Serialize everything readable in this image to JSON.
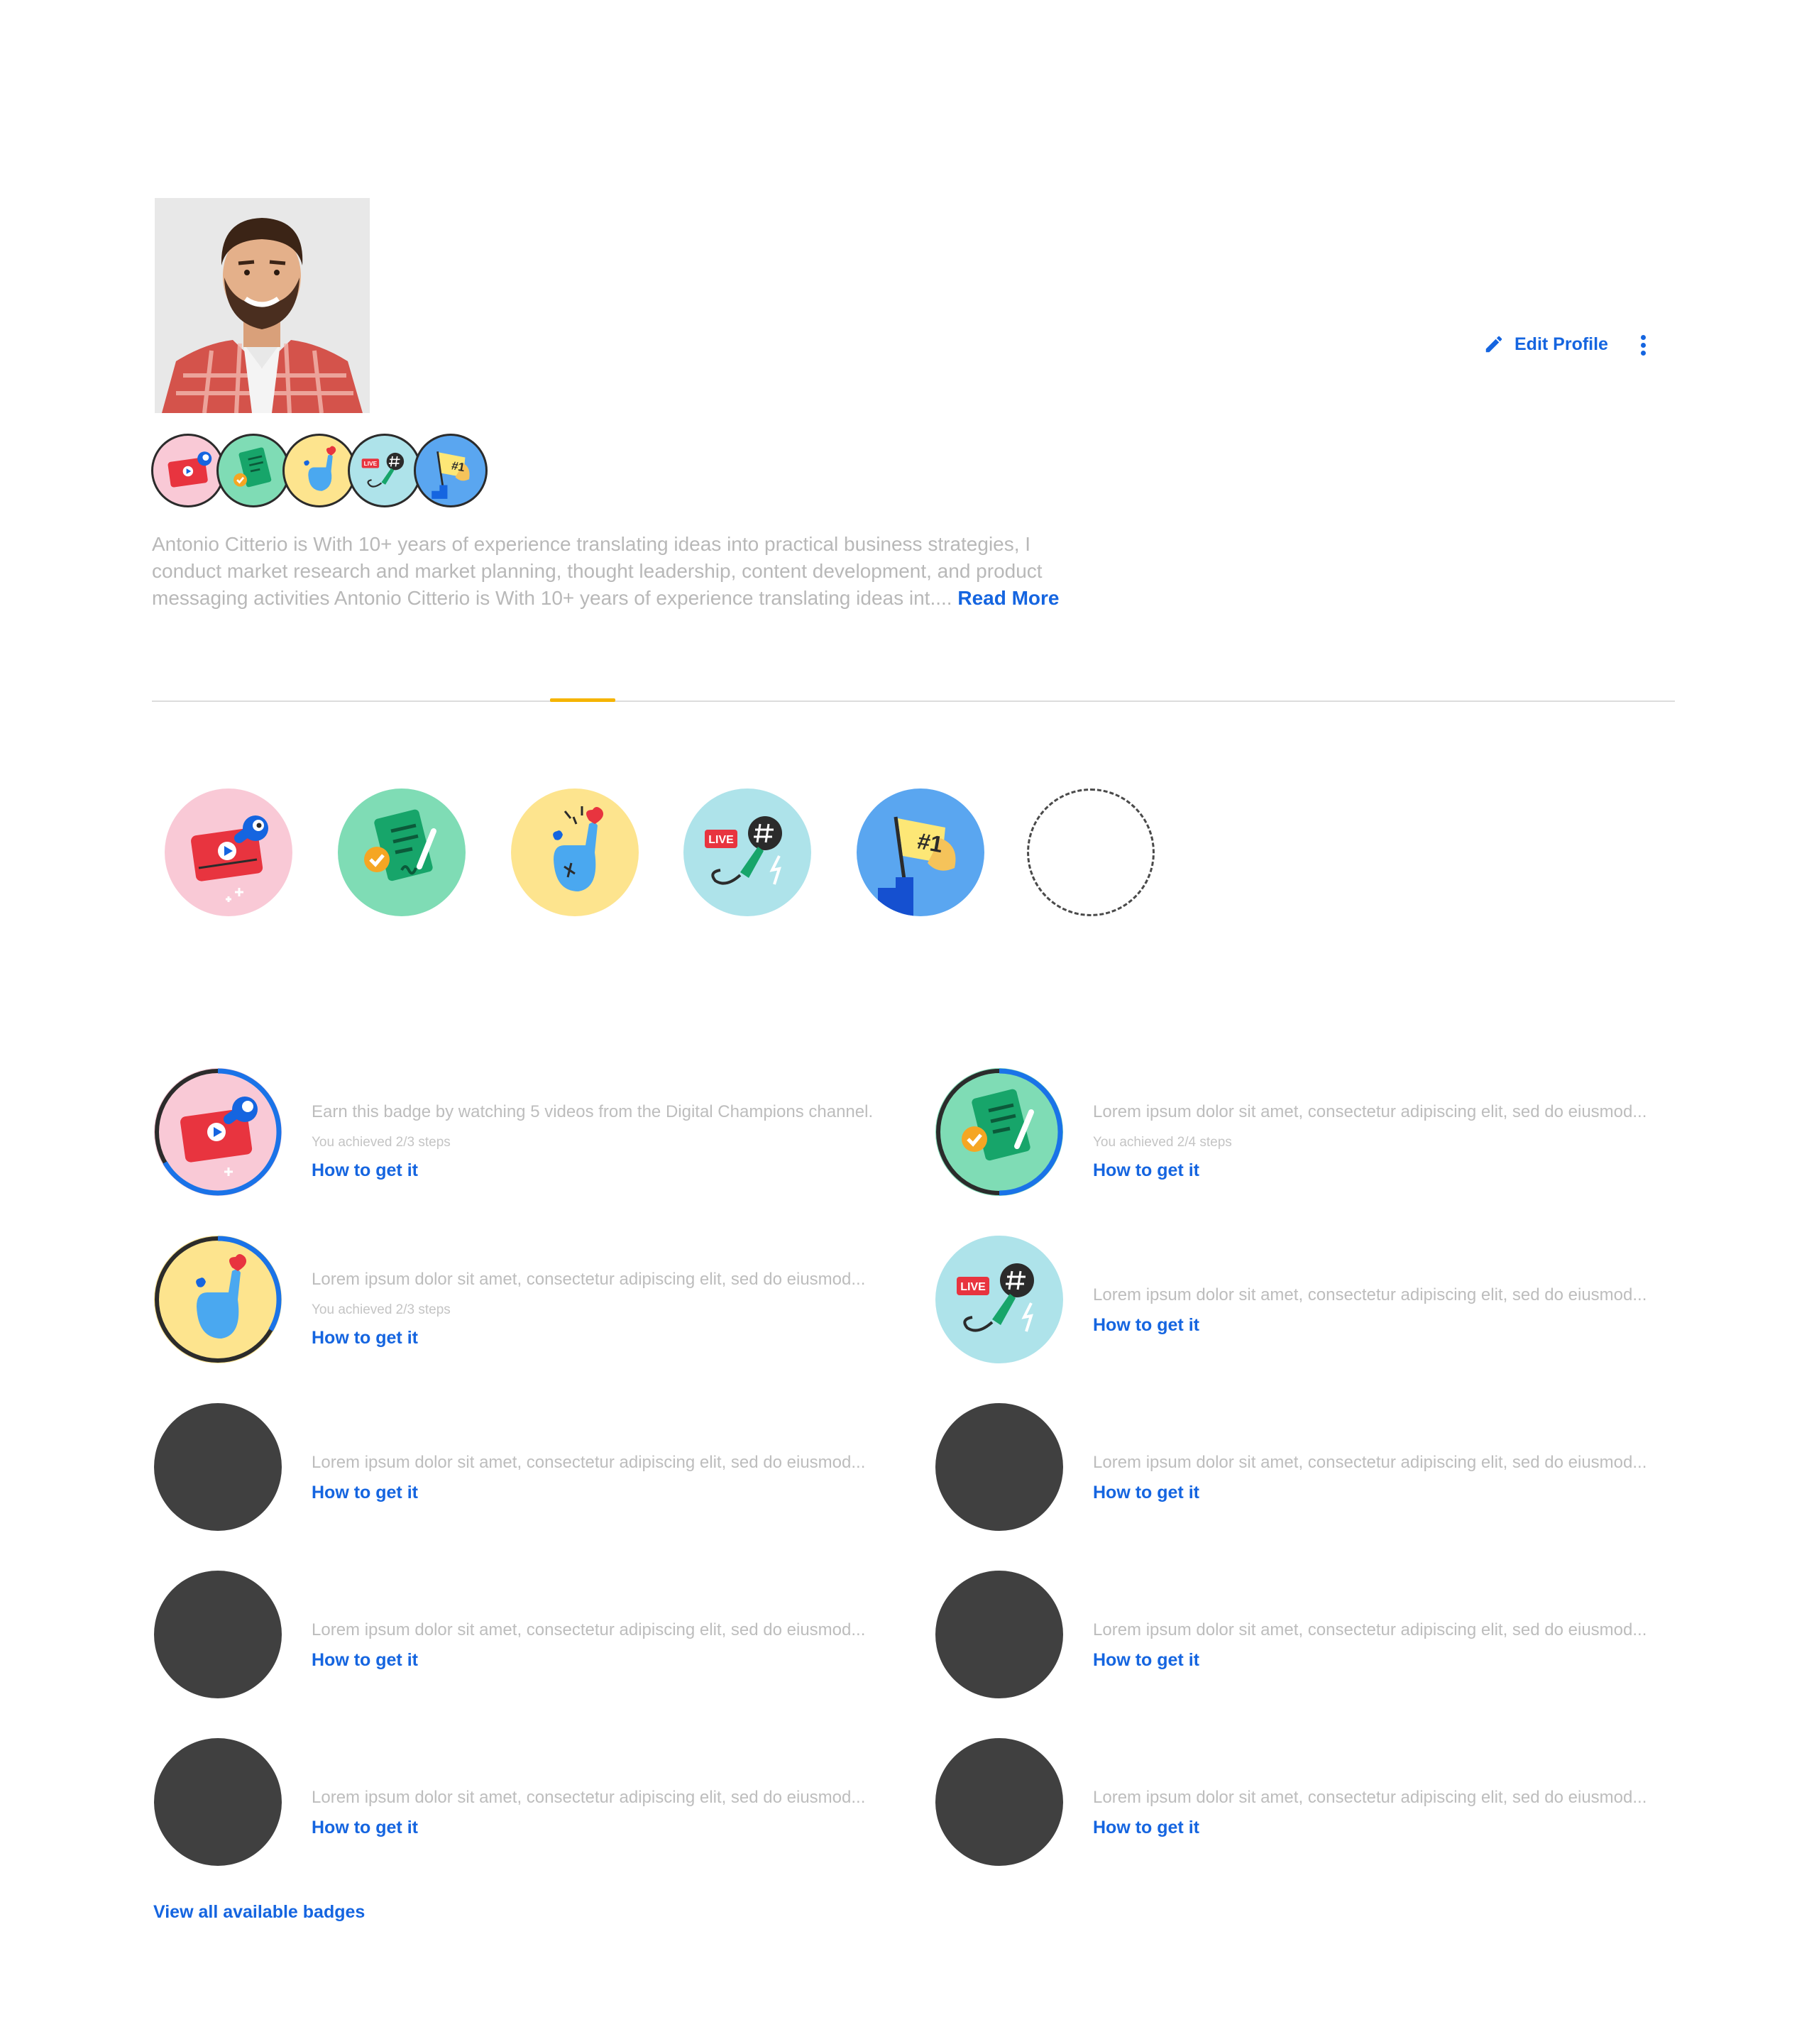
{
  "profile": {
    "name": "Antonio Citterio",
    "bio": "Antonio Citterio is With 10+ years of experience translating ideas into practical business strategies, I conduct market research and market planning, thought leadership, content development, and product messaging activities Antonio Citterio is With 10+ years of experience translating ideas int.... ",
    "read_more_label": "Read More",
    "edit_profile_label": "Edit Profile"
  },
  "mini_badges": [
    {
      "icon": "video-badge-icon",
      "color": "#f9c9d6"
    },
    {
      "icon": "document-badge-icon",
      "color": "#7fdcb5"
    },
    {
      "icon": "hand-heart-badge-icon",
      "color": "#fde48e"
    },
    {
      "icon": "live-mic-badge-icon",
      "color": "#aee3ea"
    },
    {
      "icon": "flag-number-one-badge-icon",
      "color": "#5aa6f0"
    }
  ],
  "tabs": {
    "active_indicator_color": "#f5b400"
  },
  "badge_list": [
    {
      "description": "Earn this badge by watching 5 videos from the Digital Champions channel.",
      "steps": "You achieved 2/3 steps",
      "cta": "How to get it",
      "icon": "video-badge-icon",
      "progress": 0.67
    },
    {
      "description": "Lorem ipsum dolor sit amet, consectetur adipiscing elit, sed do eiusmod...",
      "steps": "You achieved 2/4 steps",
      "cta": "How to get it",
      "icon": "document-badge-icon",
      "progress": 0.5
    },
    {
      "description": "Lorem ipsum dolor sit amet, consectetur adipiscing elit, sed do eiusmod...",
      "steps": "You achieved 2/3 steps",
      "cta": "How to get it",
      "icon": "hand-heart-badge-icon",
      "progress": 0.67
    },
    {
      "description": "Lorem ipsum dolor sit amet, consectetur adipiscing elit, sed do eiusmod...",
      "cta": "How to get it",
      "icon": "live-mic-badge-icon"
    },
    {
      "description": "Lorem ipsum dolor sit amet, consectetur adipiscing elit, sed do eiusmod...",
      "cta": "How to get it",
      "icon": "locked-badge-icon"
    },
    {
      "description": "Lorem ipsum dolor sit amet, consectetur adipiscing elit, sed do eiusmod...",
      "cta": "How to get it",
      "icon": "locked-badge-icon"
    },
    {
      "description": "Lorem ipsum dolor sit amet, consectetur adipiscing elit, sed do eiusmod...",
      "cta": "How to get it",
      "icon": "locked-badge-icon"
    },
    {
      "description": "Lorem ipsum dolor sit amet, consectetur adipiscing elit, sed do eiusmod...",
      "cta": "How to get it",
      "icon": "locked-badge-icon"
    },
    {
      "description": "Lorem ipsum dolor sit amet, consectetur adipiscing elit, sed do eiusmod...",
      "cta": "How to get it",
      "icon": "locked-badge-icon"
    },
    {
      "description": "Lorem ipsum dolor sit amet, consectetur adipiscing elit, sed do eiusmod...",
      "cta": "How to get it",
      "icon": "locked-badge-icon"
    }
  ],
  "view_all_label": "View all available badges",
  "colors": {
    "accent": "#1565e0",
    "progress_ring": "#1a73e8",
    "locked_badge": "#404040"
  }
}
